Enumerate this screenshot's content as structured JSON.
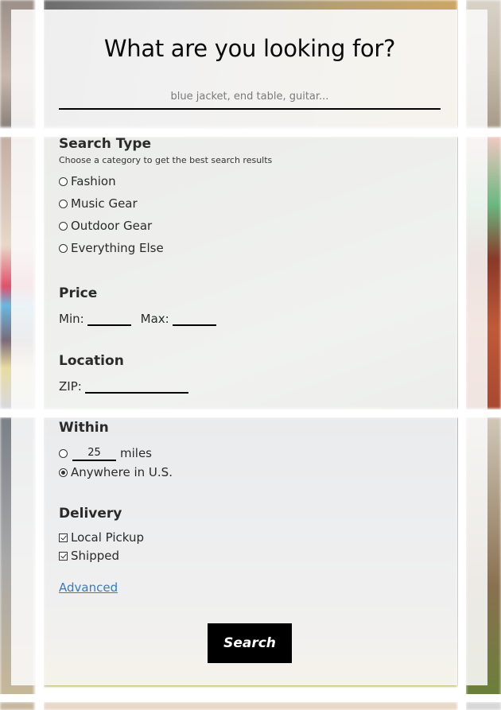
{
  "header": {
    "title": "What are you looking for?",
    "search_placeholder": "blue jacket, end table, guitar...",
    "search_value": ""
  },
  "search_type": {
    "title": "Search Type",
    "subtitle": "Choose a category to get the best search results",
    "options": [
      {
        "label": "Fashion",
        "selected": false
      },
      {
        "label": "Music Gear",
        "selected": false
      },
      {
        "label": "Outdoor Gear",
        "selected": false
      },
      {
        "label": "Everything Else",
        "selected": false
      }
    ]
  },
  "price": {
    "title": "Price",
    "min_label": "Min:",
    "min_value": "",
    "max_label": "Max:",
    "max_value": ""
  },
  "location": {
    "title": "Location",
    "zip_label": "ZIP:",
    "zip_value": ""
  },
  "within": {
    "title": "Within",
    "radius_value": "25",
    "radius_unit": "miles",
    "radius_selected": false,
    "anywhere_label": "Anywhere in U.S.",
    "anywhere_selected": true
  },
  "delivery": {
    "title": "Delivery",
    "options": [
      {
        "label": "Local Pickup",
        "checked": true
      },
      {
        "label": "Shipped",
        "checked": true
      }
    ]
  },
  "links": {
    "advanced": "Advanced"
  },
  "actions": {
    "search_label": "Search"
  },
  "colors": {
    "link": "#3a7ab8",
    "button_bg": "#000000",
    "button_text": "#ffffff"
  }
}
